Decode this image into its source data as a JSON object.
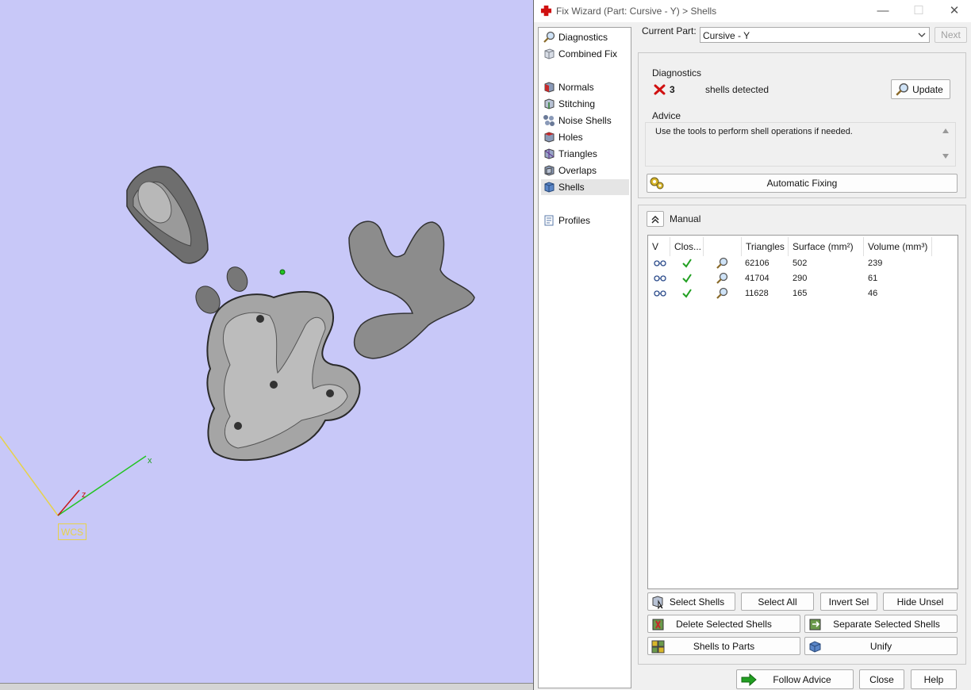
{
  "window": {
    "title": "Fix Wizard (Part: Cursive - Y) > Shells",
    "minimize_glyph": "—",
    "maximize_glyph": "☐",
    "close_glyph": "✕"
  },
  "viewport": {
    "axis_x_label": "x",
    "axis_z_label": "z",
    "wcs_label": "WCS"
  },
  "nav": {
    "items": [
      {
        "label": "Diagnostics",
        "icon": "magnifier-icon"
      },
      {
        "label": "Combined Fix",
        "icon": "cube-combined-icon"
      },
      {
        "label": "Normals",
        "icon": "normals-icon"
      },
      {
        "label": "Stitching",
        "icon": "stitching-icon"
      },
      {
        "label": "Noise Shells",
        "icon": "noise-shells-icon"
      },
      {
        "label": "Holes",
        "icon": "holes-icon"
      },
      {
        "label": "Triangles",
        "icon": "triangles-icon"
      },
      {
        "label": "Overlaps",
        "icon": "overlaps-icon"
      },
      {
        "label": "Shells",
        "icon": "shells-icon"
      },
      {
        "label": "Profiles",
        "icon": "profiles-icon"
      }
    ],
    "selected": "Shells"
  },
  "current_part": {
    "label": "Current Part:",
    "value": "Cursive - Y",
    "next_label": "Next"
  },
  "diagnostics": {
    "title": "Diagnostics",
    "count": "3",
    "message": "shells detected",
    "update_label": "Update",
    "status_color": "#d01010"
  },
  "advice": {
    "title": "Advice",
    "text": "Use the tools to perform shell operations if needed."
  },
  "automatic_fixing_label": "Automatic Fixing",
  "manual": {
    "title": "Manual",
    "columns": [
      "V",
      "Clos...",
      "",
      "Triangles",
      "Surface (mm²)",
      "Volume (mm³)"
    ],
    "rows": [
      {
        "triangles": "62106",
        "surface": "502",
        "volume": "239"
      },
      {
        "triangles": "41704",
        "surface": "290",
        "volume": "61"
      },
      {
        "triangles": "11628",
        "surface": "165",
        "volume": "46"
      }
    ]
  },
  "actions": {
    "select_shells": "Select Shells",
    "select_all": "Select All",
    "invert_sel": "Invert Sel",
    "hide_unsel": "Hide Unsel",
    "delete_selected_shells": "Delete Selected Shells",
    "separate_selected_shells": "Separate Selected Shells",
    "shells_to_parts": "Shells to Parts",
    "unify": "Unify"
  },
  "footer": {
    "follow_advice": "Follow Advice",
    "close": "Close",
    "help": "Help"
  },
  "colors": {
    "viewport_bg": "#c8c8f8",
    "axis_x": "#22c422",
    "axis_y": "#e6d24a",
    "axis_z": "#c41a1a",
    "accent_green": "#22a022"
  }
}
